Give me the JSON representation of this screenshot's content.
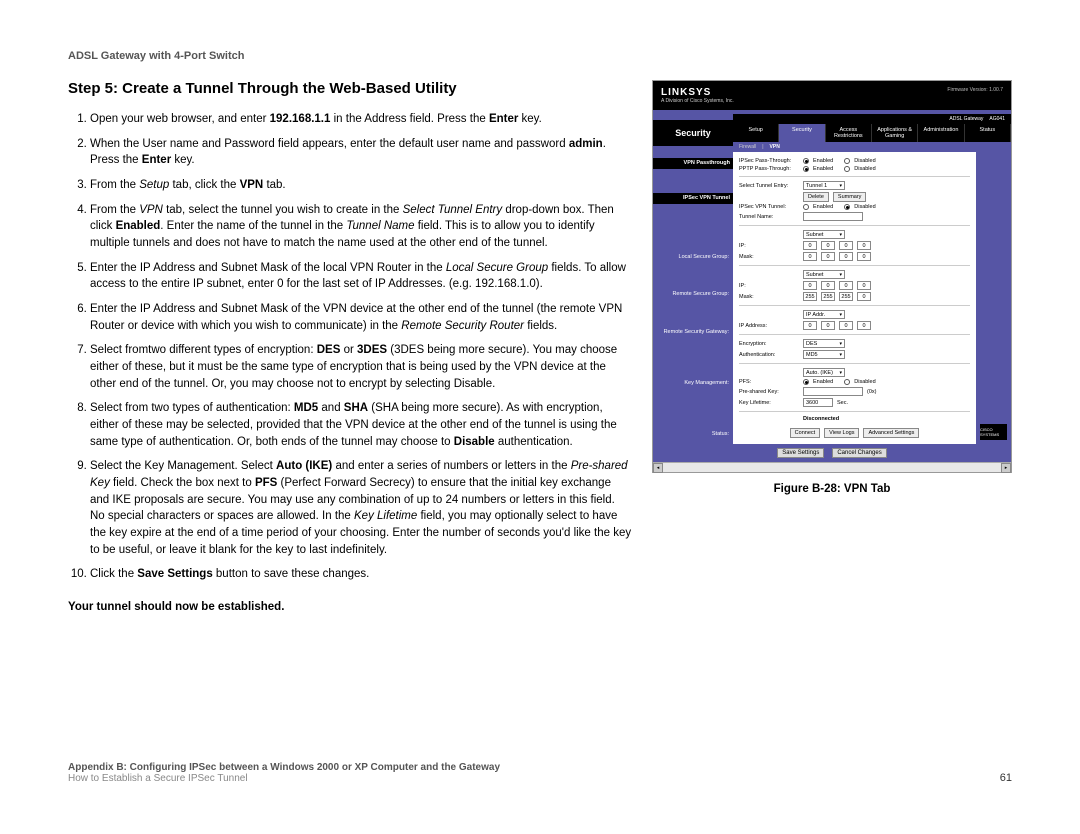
{
  "header": {
    "product": "ADSL Gateway with 4-Port Switch"
  },
  "step": {
    "title": "Step 5: Create a Tunnel Through the Web-Based Utility",
    "items": {
      "1": {
        "a": "Open your web browser, and enter ",
        "b": "192.168.1.1",
        "c": " in the Address field. Press the ",
        "d": "Enter",
        "e": " key."
      },
      "2": {
        "a": "When the User name and Password field appears, enter the default user name and password ",
        "b": "admin",
        "c": ". Press the ",
        "d": "Enter",
        "e": " key."
      },
      "3": {
        "a": "From the ",
        "b": "Setup",
        "c": " tab, click the ",
        "d": "VPN",
        "e": " tab."
      },
      "4": {
        "a": "From the ",
        "b": "VPN",
        "c": " tab, select the tunnel you wish to create in the ",
        "d": "Select Tunnel Entry",
        "e": " drop-down box. Then click ",
        "f": "Enabled",
        "g": ". Enter the name of the tunnel in the ",
        "h": "Tunnel Name",
        "i": " field.  This is to allow you to identify multiple tunnels and does not have to match the name used at the other end of the tunnel."
      },
      "5": {
        "a": "Enter the IP Address and Subnet Mask of the local VPN Router in the ",
        "b": "Local Secure Group",
        "c": " fields. To allow access to the entire IP subnet, enter 0 for the last set of IP Addresses. (e.g. 192.168.1.0)."
      },
      "6": {
        "a": "Enter the IP Address and Subnet Mask of the VPN device at the other end of the tunnel (the remote VPN Router or device with which you wish to communicate) in the ",
        "b": "Remote Security Router",
        "c": " fields."
      },
      "7": {
        "a": "Select fromtwo different types of encryption: ",
        "b": "DES",
        "c": " or ",
        "d": "3DES",
        "e": " (3DES being more secure).  You may choose either of these, but it must be the same type of encryption that is being used by the VPN device at the other end of the tunnel.  Or, you may choose not to encrypt by selecting Disable."
      },
      "8": {
        "a": "Select from two types of authentication: ",
        "b": "MD5",
        "c": " and ",
        "d": "SHA",
        "e": " (SHA being more secure).  As with encryption, either of these may be selected, provided that the VPN device at the other end of the tunnel is using the same type of authentication.  Or, both ends of the tunnel may choose to ",
        "f": "Disable",
        "g": " authentication."
      },
      "9": {
        "a": "Select the Key Management. Select ",
        "b": "Auto (IKE)",
        "c": " and enter a series of numbers or letters in the ",
        "d": "Pre-shared Key",
        "e": " field. Check the box next to ",
        "f": "PFS",
        "g": " (Perfect Forward Secrecy) to ensure that the initial key exchange and IKE proposals are secure. You may use any combination of up to 24 numbers or letters in this field. No special characters or spaces are allowed. In the ",
        "h": "Key Lifetime",
        "i": " field, you may optionally select to have the key expire at the end of a time period of your choosing.  Enter the number of seconds you'd like the key to be useful, or leave it blank for the key to last indefinitely."
      },
      "10": {
        "a": "Click the ",
        "b": "Save Settings",
        "c": " button to save these changes."
      }
    },
    "conclusion": "Your tunnel should now be established."
  },
  "figure": {
    "caption": "Figure B-28: VPN Tab"
  },
  "screenshot": {
    "brand": "LINKSYS",
    "brand_sub": "A Division of Cisco Systems, Inc.",
    "firmware": "Firmware Version: 1.00.7",
    "model_label": "ADSL Gateway",
    "model": "AG041",
    "security_label": "Security",
    "tabs": {
      "setup": "Setup",
      "security": "Security",
      "access": "Access Restrictions",
      "apps": "Applications & Gaming",
      "admin": "Administration",
      "status": "Status"
    },
    "subtabs": {
      "firewall": "Firewall",
      "vpn": "VPN"
    },
    "sections": {
      "passthru_hdr": "VPN Passthrough",
      "ipsec_pt": "IPSec Pass-Through:",
      "pptp_pt": "PPTP Pass-Through:",
      "enabled": "Enabled",
      "disabled": "Disabled",
      "tunnel_hdr": "IPSec VPN Tunnel",
      "sel_tunnel": "Select Tunnel Entry:",
      "tunnel_val": "Tunnel 1",
      "delete": "Delete",
      "summary": "Summary",
      "ipsec_vpn": "IPSec VPN Tunnel:",
      "tunnel_name": "Tunnel Name:",
      "local_hdr": "Local Secure Group:",
      "remote_hdr": "Remote Secure Group:",
      "gateway_hdr": "Remote Security Gateway:",
      "subnet": "Subnet",
      "ip": "IP:",
      "mask": "Mask:",
      "ipaddr_sel": "IP Addr.",
      "ipaddr_lbl": "IP Address:",
      "encryption": "Encryption:",
      "des": "DES",
      "auth": "Authentication:",
      "md5": "MD5",
      "keymgmt_hdr": "Key Management:",
      "autoike": "Auto. (IKE)",
      "pfs": "PFS:",
      "psk": "Pre-shared Key:",
      "keylife": "Key Lifetime:",
      "keylife_val": "3600",
      "sec": "Sec.",
      "status_hdr": "Status:",
      "disconnected": "Disconnected",
      "connect": "Connect",
      "viewlogs": "View Logs",
      "advanced": "Advanced Settings",
      "save": "Save Settings",
      "cancel": "Cancel Changes",
      "cisco": "CISCO SYSTEMS",
      "zero": "0",
      "m255": "255"
    }
  },
  "footer": {
    "line1": "Appendix B: Configuring IPSec between a Windows 2000 or XP Computer and the Gateway",
    "line2": "How to Establish a Secure IPSec Tunnel",
    "page": "61"
  }
}
